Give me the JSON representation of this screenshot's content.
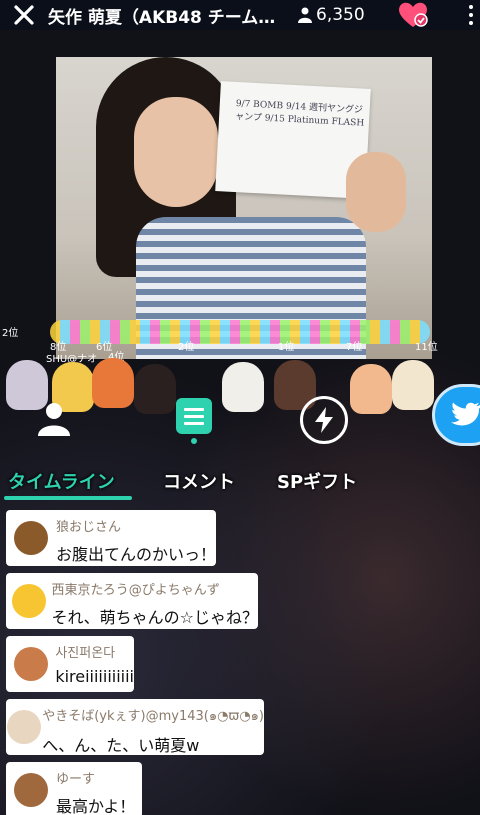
{
  "header": {
    "title": "矢作 萌夏（AKB48 チームK…",
    "viewer_count": "6,350"
  },
  "tabs": [
    {
      "label": "タイムライン",
      "active": true
    },
    {
      "label": "コメント",
      "active": false
    },
    {
      "label": "SPギフト",
      "active": false
    }
  ],
  "video": {
    "paper_text": "9/7 BOMB  9/14 週刊ヤングジャンプ  9/15 Platinum FLASH"
  },
  "gift_ranks": [
    "2位",
    "SHU@ナオ",
    "4位",
    "8位",
    "6位",
    "2位",
    "7位",
    "11位",
    "1位"
  ],
  "comments": [
    {
      "name": "狼おじさん",
      "text": "お腹出てんのかいっ！",
      "avatar_color": "#8b5a2b"
    },
    {
      "name": "西東京たろう@ぴよちゃんず",
      "text": "それ、萌ちゃんの☆じゃね？",
      "avatar_color": "#f7c531"
    },
    {
      "name": "사진퍼온다",
      "text": "kireiiiiiiiiiii",
      "avatar_color": "#c97b4a"
    },
    {
      "name": "やきそば(ykぇす)@my143(๑◔ϖ◔๑)",
      "text": "へ、ん、た、い萌夏w",
      "avatar_color": "#e9d6c0"
    },
    {
      "name": "ゆーす",
      "text": "最高かよ！",
      "avatar_color": "#a0683d"
    }
  ],
  "colors": {
    "accent": "#2ed2ae",
    "heart": "#ff4f7b",
    "twitter": "#1da1f2"
  }
}
